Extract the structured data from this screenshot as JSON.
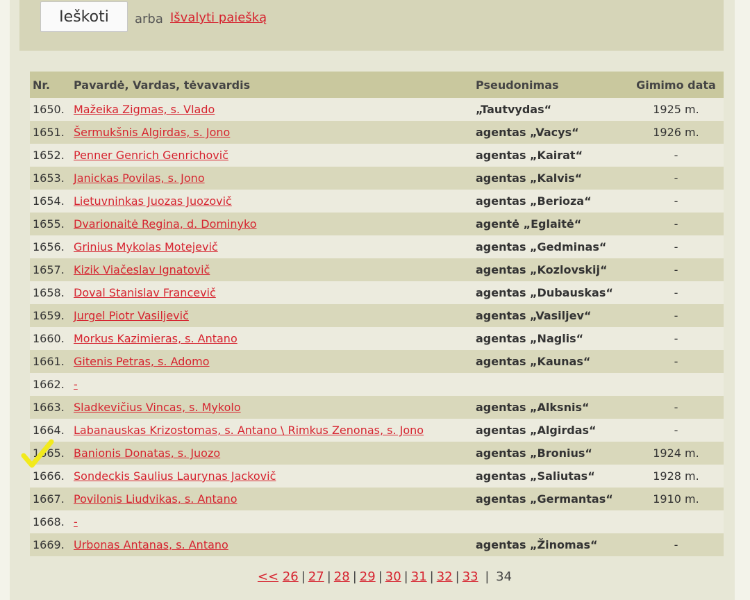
{
  "search": {
    "button_label": "Ieškoti",
    "or_text": "arba",
    "clear_link": "Išvalyti paiešką"
  },
  "table": {
    "headers": {
      "nr": "Nr.",
      "name": "Pavardė, Vardas, tėvavardis",
      "pseudonym": "Pseudonimas",
      "birth": "Gimimo data"
    },
    "rows": [
      {
        "nr": "1650.",
        "name": "Mažeika Zigmas, s. Vlado",
        "pseudonym": "„Tautvydas“",
        "birth": "1925 m."
      },
      {
        "nr": "1651.",
        "name": "Šermukšnis Algirdas, s. Jono",
        "pseudonym": "agentas „Vacys“",
        "birth": "1926 m."
      },
      {
        "nr": "1652.",
        "name": "Penner Genrich Genrichovič",
        "pseudonym": "agentas „Kairat“",
        "birth": "-"
      },
      {
        "nr": "1653.",
        "name": "Janickas Povilas, s. Jono",
        "pseudonym": "agentas „Kalvis“",
        "birth": "-"
      },
      {
        "nr": "1654.",
        "name": "Lietuvninkas Juozas Juozovič",
        "pseudonym": "agentas „Berioza“",
        "birth": "-"
      },
      {
        "nr": "1655.",
        "name": "Dvarionaitė Regina, d. Dominyko",
        "pseudonym": "agentė „Eglaitė“",
        "birth": "-"
      },
      {
        "nr": "1656.",
        "name": "Grinius Mykolas Motejevič",
        "pseudonym": "agentas „Gedminas“",
        "birth": "-"
      },
      {
        "nr": "1657.",
        "name": "Kizik Viačeslav Ignatovič",
        "pseudonym": "agentas „Kozlovskij“",
        "birth": "-"
      },
      {
        "nr": "1658.",
        "name": "Doval Stanislav Francevič",
        "pseudonym": "agentas „Dubauskas“",
        "birth": "-"
      },
      {
        "nr": "1659.",
        "name": "Jurgel Piotr Vasiljevič",
        "pseudonym": "agentas „Vasiljev“",
        "birth": "-"
      },
      {
        "nr": "1660.",
        "name": "Morkus Kazimieras, s. Antano",
        "pseudonym": "agentas „Naglis“",
        "birth": "-"
      },
      {
        "nr": "1661.",
        "name": "Gitenis Petras, s. Adomo",
        "pseudonym": "agentas „Kaunas“",
        "birth": "-"
      },
      {
        "nr": "1662.",
        "name": "-",
        "pseudonym": "",
        "birth": ""
      },
      {
        "nr": "1663.",
        "name": "Sladkevičius Vincas, s. Mykolo",
        "pseudonym": "agentas „Alksnis“",
        "birth": "-"
      },
      {
        "nr": "1664.",
        "name": "Labanauskas Krizostomas, s. Antano \\ Rimkus Zenonas, s. Jono",
        "pseudonym": "agentas „Algirdas“",
        "birth": "-"
      },
      {
        "nr": "1665.",
        "name": "Banionis Donatas, s. Juozo",
        "pseudonym": "agentas „Bronius“",
        "birth": "1924 m."
      },
      {
        "nr": "1666.",
        "name": "Sondeckis Saulius Laurynas Jackovič",
        "pseudonym": "agentas „Saliutas“",
        "birth": "1928 m."
      },
      {
        "nr": "1667.",
        "name": "Povilonis Liudvikas, s. Antano",
        "pseudonym": "agentas „Germantas“",
        "birth": "1910 m."
      },
      {
        "nr": "1668.",
        "name": "-",
        "pseudonym": "",
        "birth": ""
      },
      {
        "nr": "1669.",
        "name": "Urbonas Antanas, s. Antano",
        "pseudonym": "agentas „Žinomas“",
        "birth": "-"
      }
    ]
  },
  "pagination": {
    "first": "<<",
    "pages": [
      "26",
      "27",
      "28",
      "29",
      "30",
      "31",
      "32",
      "33"
    ],
    "current": "34"
  },
  "colors": {
    "link": "#d6232f",
    "header_bg": "#c9c89e",
    "row_alt": "#d9d8bb",
    "check_mark": "#f2ea1c"
  }
}
